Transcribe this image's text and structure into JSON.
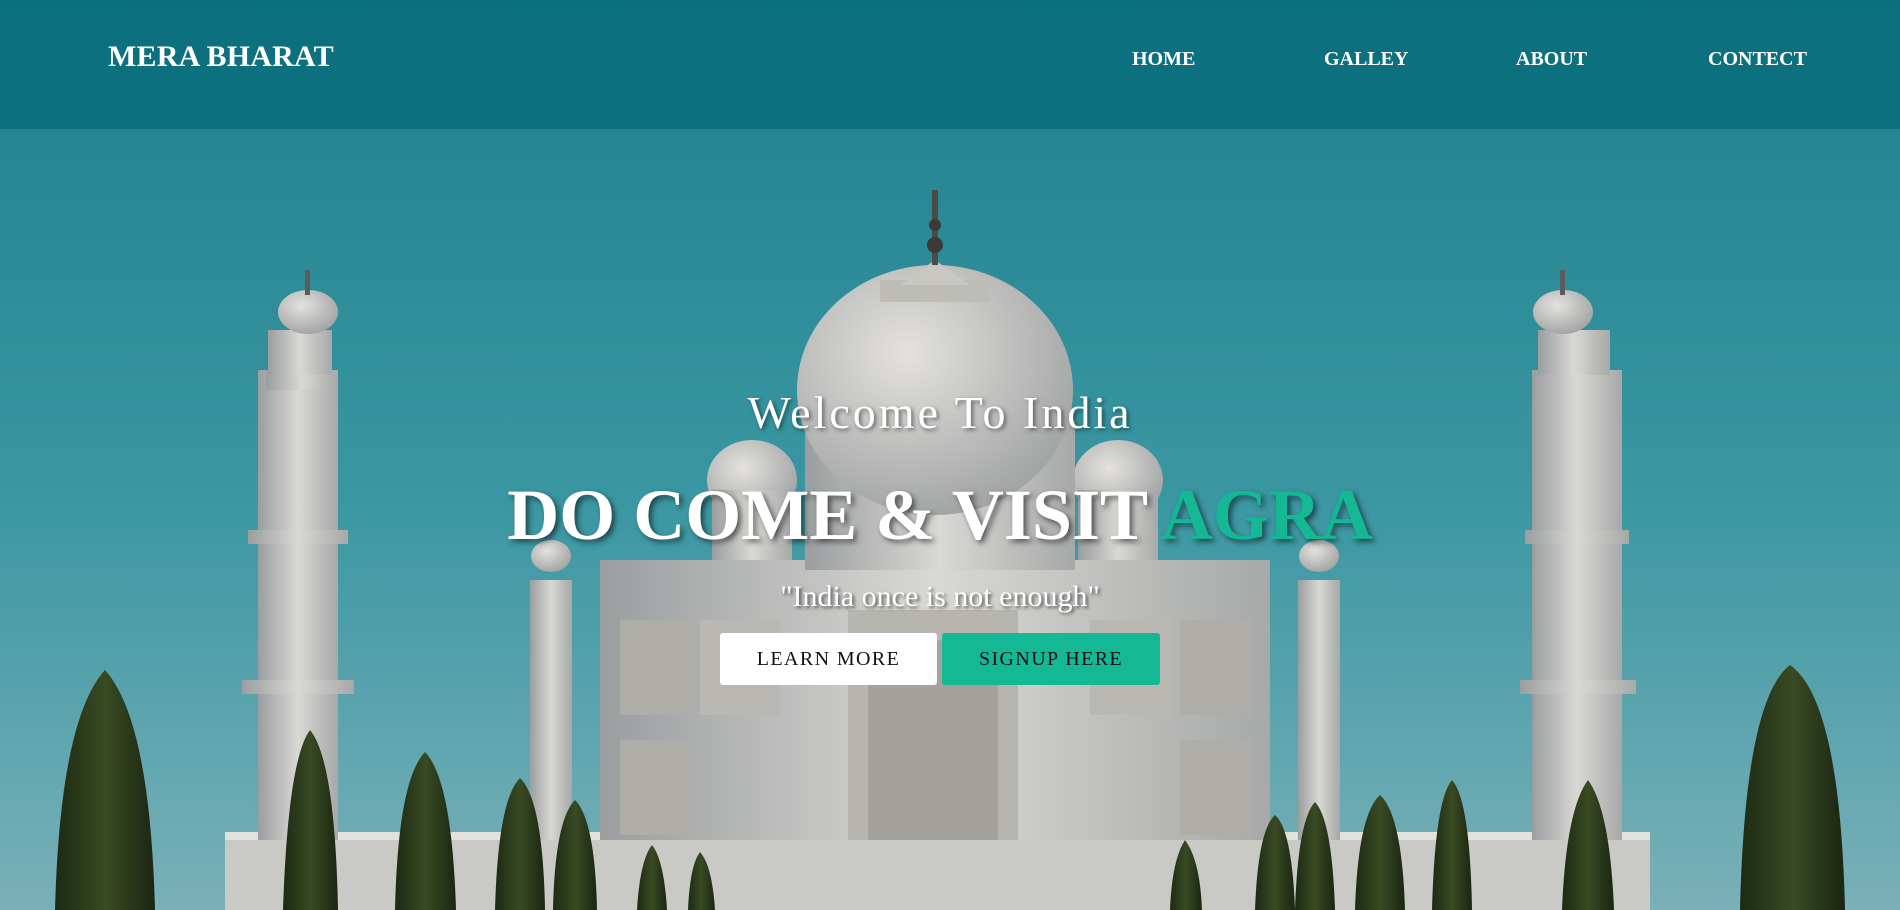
{
  "navbar": {
    "brand": "MERA BHARAT",
    "links": [
      "HOME",
      "GALLEY",
      "ABOUT",
      "CONTECT"
    ]
  },
  "hero": {
    "welcome": "Welcome To India",
    "headline_main": "DO COME & VISIT ",
    "headline_accent": "AGRA",
    "tagline": "\"India once is not enough\"",
    "buttons": {
      "learn_more": "LEARN MORE",
      "signup": "SIGNUP HERE"
    }
  },
  "colors": {
    "accent": "#15b894",
    "navbar": "#076c7a",
    "sky": "#2c8a97"
  }
}
